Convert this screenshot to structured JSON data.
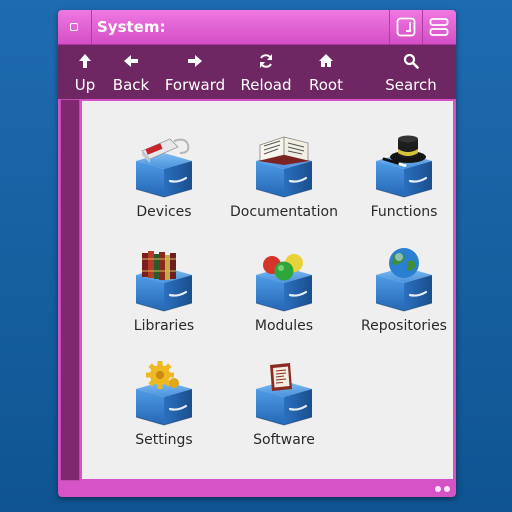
{
  "window": {
    "title": "System:"
  },
  "toolbar": {
    "up": {
      "label": "Up",
      "icon": "arrow-up-icon"
    },
    "back": {
      "label": "Back",
      "icon": "arrow-left-icon"
    },
    "forward": {
      "label": "Forward",
      "icon": "arrow-right-icon"
    },
    "reload": {
      "label": "Reload",
      "icon": "reload-icon"
    },
    "root": {
      "label": "Root",
      "icon": "home-icon"
    },
    "search": {
      "label": "Search",
      "icon": "search-icon"
    }
  },
  "items": [
    {
      "label": "Devices",
      "icon": "devices-drawer-icon"
    },
    {
      "label": "Documentation",
      "icon": "documentation-drawer-icon"
    },
    {
      "label": "Functions",
      "icon": "functions-drawer-icon"
    },
    {
      "label": "Libraries",
      "icon": "libraries-drawer-icon"
    },
    {
      "label": "Modules",
      "icon": "modules-drawer-icon"
    },
    {
      "label": "Repositories",
      "icon": "repositories-drawer-icon"
    },
    {
      "label": "Settings",
      "icon": "settings-drawer-icon"
    },
    {
      "label": "Software",
      "icon": "software-drawer-icon"
    }
  ],
  "colors": {
    "desktop": "#155f9f",
    "window_frame": "#d552c7",
    "toolbar": "#6e2762",
    "content_bg": "#efefef"
  }
}
